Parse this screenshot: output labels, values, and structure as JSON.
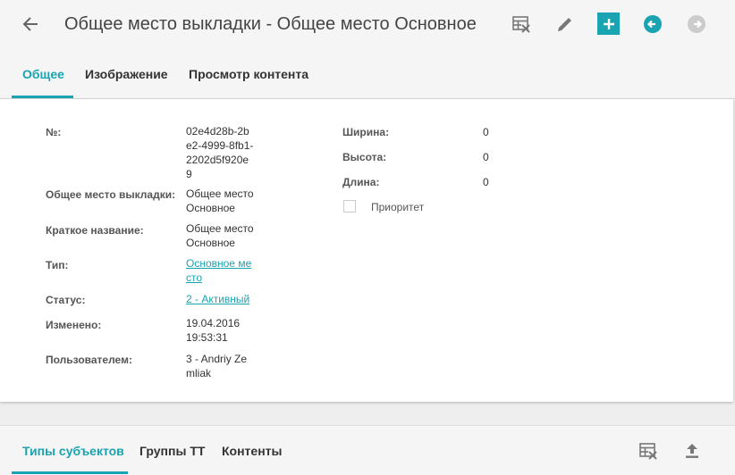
{
  "header": {
    "title": "Общее место выкладки - Общее место Основное"
  },
  "tabs": [
    {
      "label": "Общее"
    },
    {
      "label": "Изображение"
    },
    {
      "label": "Просмотр контента"
    }
  ],
  "fields_left": [
    {
      "label": "№:",
      "value": "02e4d28b-2be2-4999-8fb1-2202d5f920e9"
    },
    {
      "label": "Общее место выкладки:",
      "value": "Общее место Основное"
    },
    {
      "label": "Краткое название:",
      "value": "Общее место Основное"
    },
    {
      "label": "Тип:",
      "value": "Основное место"
    },
    {
      "label": "Статус:",
      "value": "2 - Активный"
    },
    {
      "label": "Изменено:",
      "value": "19.04.2016 19:53:31"
    },
    {
      "label": "Пользователем:",
      "value": "3 - Andriy Zemliak"
    }
  ],
  "fields_right": [
    {
      "label": "Ширина:",
      "value": "0"
    },
    {
      "label": "Высота:",
      "value": "0"
    },
    {
      "label": "Длина:",
      "value": "0"
    }
  ],
  "priority_label": "Приоритет",
  "bottom_tabs": [
    {
      "label": "Типы субъектов"
    },
    {
      "label": "Группы ТТ"
    },
    {
      "label": "Контенты"
    }
  ],
  "colors": {
    "accent": "#1aa3b0",
    "accent_arrow": "#1aa3b0",
    "disabled_arrow": "#cccccc"
  }
}
